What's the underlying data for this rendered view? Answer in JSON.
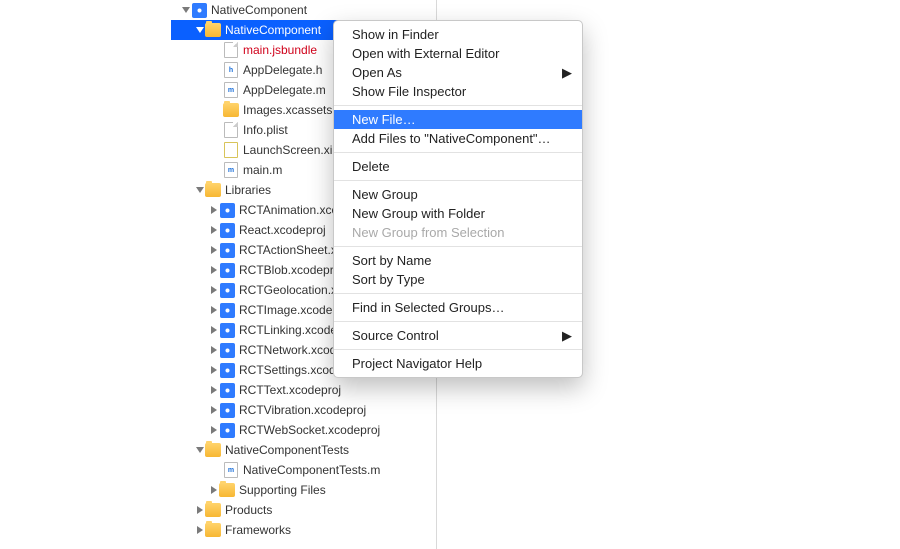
{
  "tree": {
    "root_project": "NativeComponent",
    "selected_folder": "NativeComponent",
    "files": {
      "bundle": "main.jsbundle",
      "appdelegate_h": "AppDelegate.h",
      "appdelegate_m": "AppDelegate.m",
      "images": "Images.xcassets",
      "info": "Info.plist",
      "launch": "LaunchScreen.xib",
      "main_m": "main.m"
    },
    "libraries_label": "Libraries",
    "libraries": [
      "RCTAnimation.xcodeproj",
      "React.xcodeproj",
      "RCTActionSheet.xcodeproj",
      "RCTBlob.xcodeproj",
      "RCTGeolocation.xcodeproj",
      "RCTImage.xcodeproj",
      "RCTLinking.xcodeproj",
      "RCTNetwork.xcodeproj",
      "RCTSettings.xcodeproj",
      "RCTText.xcodeproj",
      "RCTVibration.xcodeproj",
      "RCTWebSocket.xcodeproj"
    ],
    "tests_folder": "NativeComponentTests",
    "tests_file": "NativeComponentTests.m",
    "supporting": "Supporting Files",
    "products": "Products",
    "frameworks": "Frameworks"
  },
  "menu": {
    "show_finder": "Show in Finder",
    "open_external": "Open with External Editor",
    "open_as": "Open As",
    "inspector": "Show File Inspector",
    "new_file": "New File…",
    "add_files": "Add Files to \"NativeComponent\"…",
    "delete": "Delete",
    "new_group": "New Group",
    "new_group_folder": "New Group with Folder",
    "new_group_sel": "New Group from Selection",
    "sort_name": "Sort by Name",
    "sort_type": "Sort by Type",
    "find": "Find in Selected Groups…",
    "source_control": "Source Control",
    "help": "Project Navigator Help"
  }
}
